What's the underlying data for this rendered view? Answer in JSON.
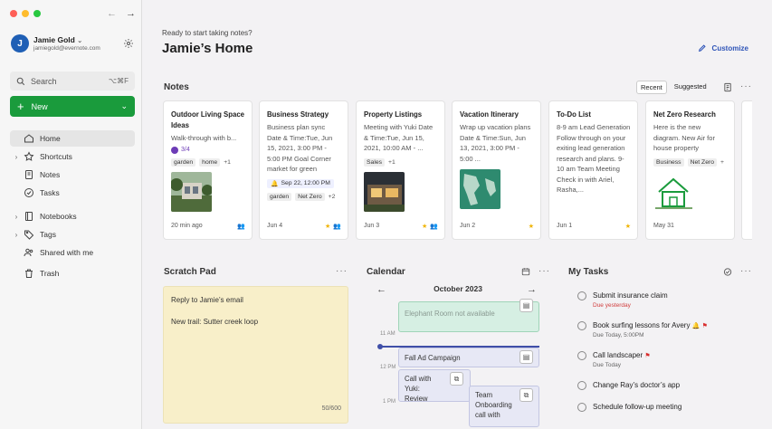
{
  "sidebar": {
    "traffic": [
      "#fe5f57",
      "#febc2e",
      "#28c840"
    ],
    "account": {
      "initial": "J",
      "name": "Jamie Gold",
      "email": "jamiegold@evernote.com"
    },
    "search": {
      "label": "Search",
      "shortcut": "⌥⌘F"
    },
    "new_label": "New",
    "items": [
      {
        "label": "Home",
        "icon": "home-icon"
      },
      {
        "label": "Shortcuts",
        "icon": "star-icon"
      },
      {
        "label": "Notes",
        "icon": "note-icon"
      },
      {
        "label": "Tasks",
        "icon": "check-circle-icon"
      },
      {
        "label": "Notebooks",
        "icon": "notebook-icon"
      },
      {
        "label": "Tags",
        "icon": "tag-icon"
      },
      {
        "label": "Shared with me",
        "icon": "people-icon"
      },
      {
        "label": "Trash",
        "icon": "trash-icon"
      }
    ]
  },
  "header": {
    "greeting": "Ready to start taking notes?",
    "title": "Jamie’s Home",
    "customize": "Customize"
  },
  "notes": {
    "title": "Notes",
    "tabs": [
      "Recent",
      "Suggested"
    ],
    "cards": [
      {
        "title": "Outdoor Living Space Ideas",
        "body": "Walk-through with b...",
        "checks": "3/4",
        "tags": [
          "garden",
          "home"
        ],
        "more": "+1",
        "date": "20 min ago"
      },
      {
        "title": "Business Strategy",
        "body": "Business plan sync Date & Time:Tue, Jun 15, 2021, 3:00 PM - 5:00 PM Goal Corner market for green",
        "reminder": "Sep 22, 12:00 PM",
        "tags": [
          "garden",
          "Net Zero"
        ],
        "more": "+2",
        "date": "Jun 4"
      },
      {
        "title": "Property Listings",
        "body": "Meeting with Yuki Date & Time:Tue, Jun 15, 2021, 10:00 AM - ...",
        "tags": [
          "Sales"
        ],
        "more": "+1",
        "date": "Jun 3"
      },
      {
        "title": "Vacation Itinerary",
        "body": "Wrap up vacation plans Date & Time:Sun, Jun 13, 2021, 3:00 PM - 5:00 ...",
        "date": "Jun 2"
      },
      {
        "title": "To-Do List",
        "body": "8-9 am Lead Generation Follow through on your exiting lead generation research and plans. 9-10 am Team Meeting Check in with Ariel, Rasha,...",
        "date": "Jun 1"
      },
      {
        "title": "Net Zero Research",
        "body": "Here is the new diagram. New Air for house property",
        "tags": [
          "Business",
          "Net Zero"
        ],
        "more": "+",
        "date": "May 31"
      }
    ]
  },
  "scratch": {
    "title": "Scratch Pad",
    "lines": [
      "Reply to Jamie’s email",
      "New trail: Sutter creek loop"
    ],
    "count": "50/600"
  },
  "calendar": {
    "title": "Calendar",
    "month": "October 2023",
    "times": [
      "11 AM",
      "12 PM",
      "1 PM"
    ],
    "events": [
      "Elephant Room not available",
      "Fall Ad Campaign",
      "Call with Yuki: Review",
      "Team Onboarding call with"
    ]
  },
  "tasks": {
    "title": "My Tasks",
    "items": [
      {
        "title": "Submit insurance claim",
        "due": "Due yesterday"
      },
      {
        "title": "Book surfing lessons for Avery",
        "due": "Due Today, 5:00PM"
      },
      {
        "title": "Call landscaper",
        "due": "Due Today"
      },
      {
        "title": "Change Ray’s doctor’s app",
        "due": ""
      },
      {
        "title": "Schedule follow-up meeting",
        "due": ""
      }
    ]
  }
}
